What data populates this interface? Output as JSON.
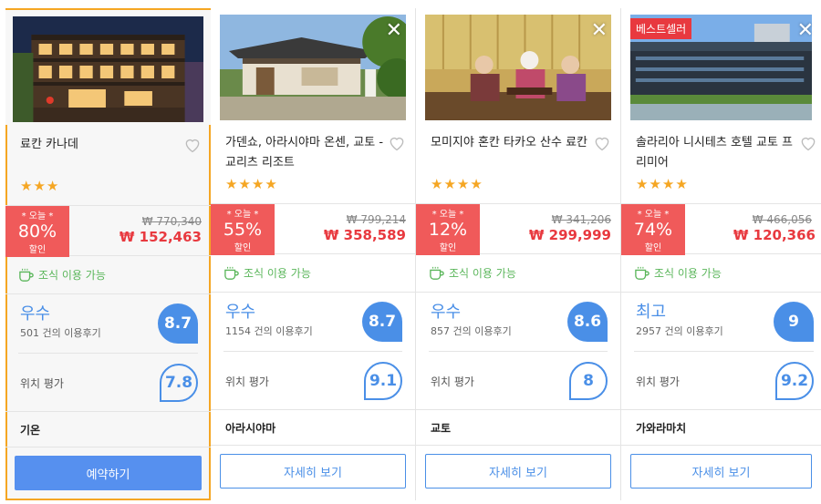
{
  "hotels": [
    {
      "name": "료칸 카나데",
      "stars": "★★★",
      "badge": "",
      "discount_today": "* 오늘 *",
      "discount_pct": "80%",
      "discount_label": "할인",
      "original_price": "₩ 770,340",
      "price": "₩ 152,463",
      "breakfast": "조식 이용 가능",
      "review_word": "우수",
      "review_count": "501 건의 이용후기",
      "review_score": "8.7",
      "location_label": "위치 평가",
      "location_score": "7.8",
      "area": "기온",
      "button": "예약하기"
    },
    {
      "name": "가덴쇼, 아라시야마 온센, 교토 - 교리츠 리조트",
      "stars": "★★★★",
      "badge": "",
      "discount_today": "* 오늘 *",
      "discount_pct": "55%",
      "discount_label": "할인",
      "original_price": "₩ 799,214",
      "price": "₩ 358,589",
      "breakfast": "조식 이용 가능",
      "review_word": "우수",
      "review_count": "1154 건의 이용후기",
      "review_score": "8.7",
      "location_label": "위치 평가",
      "location_score": "9.1",
      "area": "아라시야마",
      "button": "자세히 보기"
    },
    {
      "name": "모미지야 혼칸 타카오 산수 료칸",
      "stars": "★★★★",
      "badge": "",
      "discount_today": "* 오늘 *",
      "discount_pct": "12%",
      "discount_label": "할인",
      "original_price": "₩ 341,206",
      "price": "₩ 299,999",
      "breakfast": "조식 이용 가능",
      "review_word": "우수",
      "review_count": "857 건의 이용후기",
      "review_score": "8.6",
      "location_label": "위치 평가",
      "location_score": "8",
      "area": "교토",
      "button": "자세히 보기"
    },
    {
      "name": "솔라리아 니시테츠 호텔 교토 프리미어",
      "stars": "★★★★",
      "badge": "베스트셀러",
      "discount_today": "* 오늘 *",
      "discount_pct": "74%",
      "discount_label": "할인",
      "original_price": "₩ 466,056",
      "price": "₩ 120,366",
      "breakfast": "조식 이용 가능",
      "review_word": "최고",
      "review_count": "2957 건의 이용후기",
      "review_score": "9",
      "location_label": "위치 평가",
      "location_score": "9.2",
      "area": "가와라마치",
      "button": "자세히 보기"
    }
  ],
  "close_glyph": "✕",
  "colors": {
    "accent": "#4a8fe7",
    "discount": "#f05a5a",
    "price": "#e8393f",
    "star": "#f5a623",
    "breakfast": "#5ab65a",
    "selected_border": "#f5a623"
  }
}
